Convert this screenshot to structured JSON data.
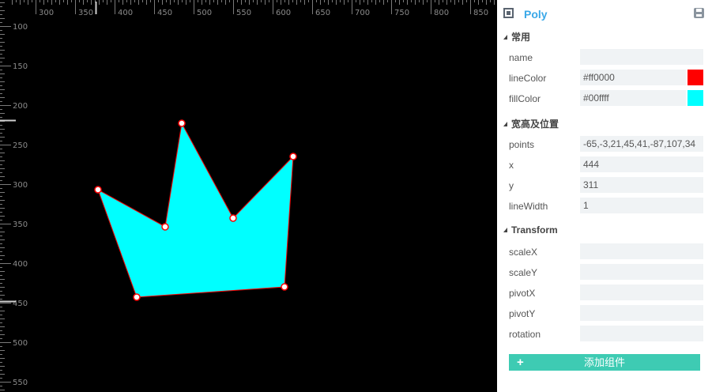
{
  "ruler": {
    "top_ticks": [
      "300",
      "350",
      "400",
      "450",
      "500",
      "550",
      "600",
      "650",
      "700",
      "750",
      "800",
      "850"
    ],
    "left_ticks": [
      "100",
      "150",
      "200",
      "250",
      "300",
      "350",
      "400",
      "450",
      "500",
      "550"
    ]
  },
  "panel": {
    "title": "Poly",
    "sections": {
      "common": "常用",
      "size_position": "宽高及位置",
      "transform": "Transform"
    },
    "fields": {
      "name": {
        "label": "name",
        "value": ""
      },
      "lineColor": {
        "label": "lineColor",
        "value": "#ff0000",
        "swatch": "#ff0000"
      },
      "fillColor": {
        "label": "fillColor",
        "value": "#00ffff",
        "swatch": "#00ffff"
      },
      "points": {
        "label": "points",
        "value": "-65,-3,21,45,41,-87,107,34"
      },
      "x": {
        "label": "x",
        "value": "444"
      },
      "y": {
        "label": "y",
        "value": "311"
      },
      "lineWidth": {
        "label": "lineWidth",
        "value": "1"
      },
      "scaleX": {
        "label": "scaleX",
        "value": ""
      },
      "scaleY": {
        "label": "scaleY",
        "value": ""
      },
      "pivotX": {
        "label": "pivotX",
        "value": ""
      },
      "pivotY": {
        "label": "pivotY",
        "value": ""
      },
      "rotation": {
        "label": "rotation",
        "value": ""
      }
    },
    "add_component": "添加组件"
  },
  "colors": {
    "accent": "#3aa8e8",
    "button": "#3ecbb3",
    "line": "#ff0000",
    "fill": "#00ffff"
  }
}
